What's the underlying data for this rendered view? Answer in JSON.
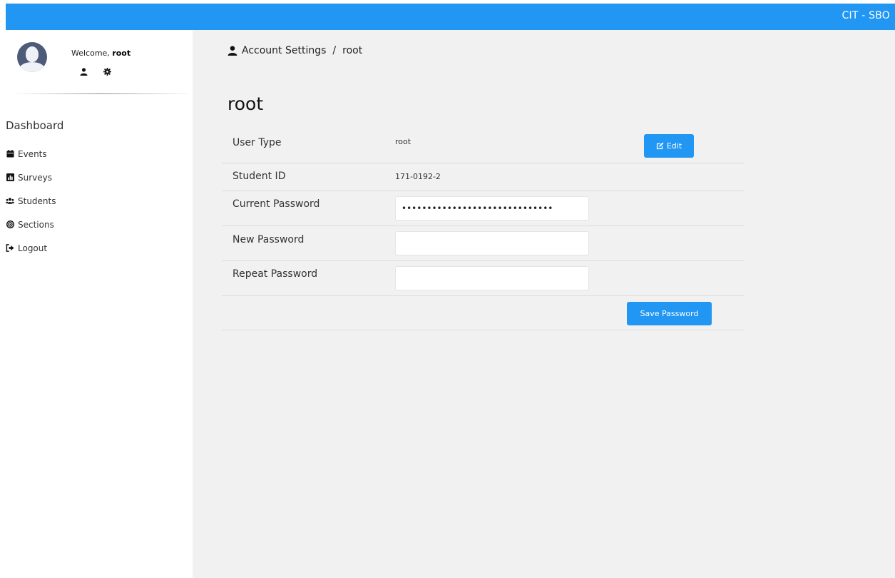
{
  "header": {
    "brand": "CIT - SBO",
    "brand_color": "#2196f3"
  },
  "sidebar": {
    "welcome_prefix": "Welcome,",
    "username": "root",
    "nav_title": "Dashboard",
    "items": [
      {
        "label": "Events",
        "icon": "calendar-icon"
      },
      {
        "label": "Surveys",
        "icon": "bar-chart-icon"
      },
      {
        "label": "Students",
        "icon": "users-icon"
      },
      {
        "label": "Sections",
        "icon": "target-icon"
      },
      {
        "label": "Logout",
        "icon": "sign-out-icon"
      }
    ]
  },
  "breadcrumb": {
    "section": "Account Settings",
    "separator": "/",
    "current": "root"
  },
  "page": {
    "title": "root"
  },
  "account": {
    "user_type_label": "User Type",
    "user_type_value": "root",
    "edit_label": "Edit",
    "student_id_label": "Student ID",
    "student_id_value": "171-0192-2",
    "current_password_label": "Current Password",
    "current_password_value": "••••••••••••••••••••••••••••••",
    "new_password_label": "New Password",
    "new_password_value": "",
    "repeat_password_label": "Repeat Password",
    "repeat_password_value": "",
    "save_label": "Save Password"
  }
}
